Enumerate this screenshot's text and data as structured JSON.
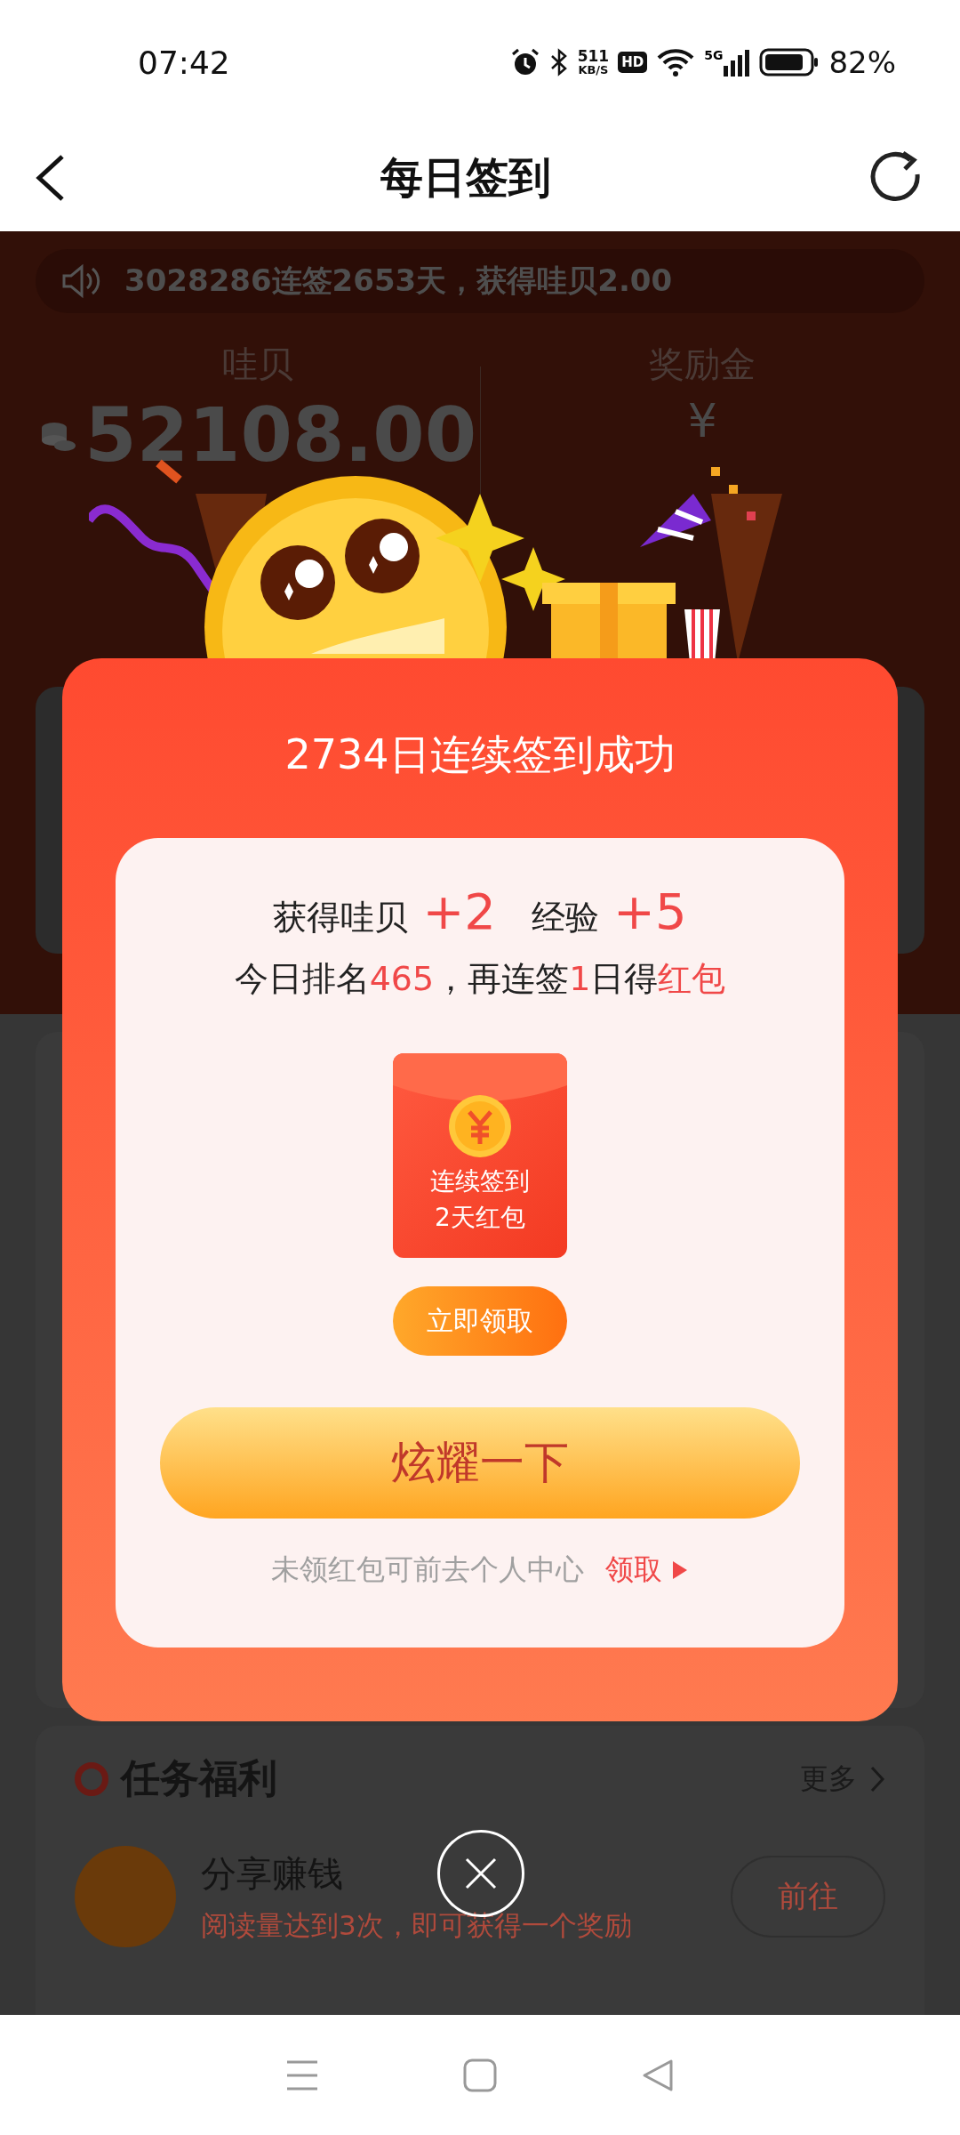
{
  "status_bar": {
    "time": "07:42",
    "net_speed_value": "511",
    "net_speed_unit": "KB/S",
    "hd_badge": "HD",
    "network": "5G",
    "battery": "82%"
  },
  "header": {
    "title": "每日签到"
  },
  "background_page": {
    "notice": "3028286连签2653天，获得哇贝2.00",
    "stats": [
      {
        "kind": "coins",
        "label": "哇贝",
        "value": "52108.00"
      },
      {
        "kind": "money",
        "label": "奖励金",
        "prefix": "¥"
      }
    ],
    "tasks": {
      "title": "任务福利",
      "more": "更多",
      "items": [
        {
          "title": "分享赚钱",
          "description": "阅读量达到3次，即可获得一个奖励",
          "action": "前往"
        }
      ]
    }
  },
  "dialog": {
    "title": "2734日连续签到成功",
    "rewards": [
      {
        "label": "获得哇贝",
        "amount": "+2"
      },
      {
        "label": "经验",
        "amount": "+5"
      }
    ],
    "rank_line": "今日排名**465**，再连签**1**日得**红包**",
    "red_packet": {
      "lines": [
        "连续签到",
        "2天红包"
      ]
    },
    "claim_button": "立即领取",
    "share_button": "炫耀一下",
    "footer_note": "未领红包可前去个人中心",
    "footer_link": "领取"
  }
}
